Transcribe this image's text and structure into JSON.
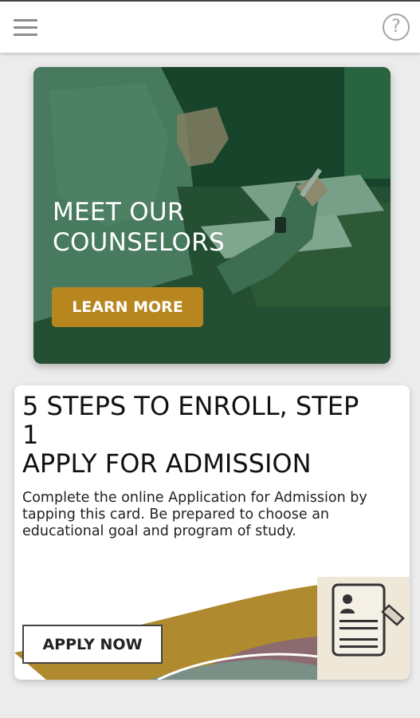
{
  "topbar": {
    "menu_icon": "hamburger-menu-icon",
    "help_icon": "question-circle-icon",
    "help_glyph": "?"
  },
  "hero": {
    "title_line1": "MEET OUR",
    "title_line2": "COUNSELORS",
    "button_label": "LEARN MORE",
    "overlay_color": "#1d5a36",
    "button_color": "#b7861f"
  },
  "step_card": {
    "title_line1": "5 STEPS TO ENROLL, STEP",
    "title_line2": "1",
    "title_line3": "APPLY FOR ADMISSION",
    "description": "Complete the online Application for Admission by tapping this card. Be prepared to choose an educational goal and program of study.",
    "button_label": "APPLY NOW",
    "illustration_icon": "application-form-icon",
    "accent_gold": "#b28b2a",
    "accent_mauve": "#8a6a6e"
  }
}
